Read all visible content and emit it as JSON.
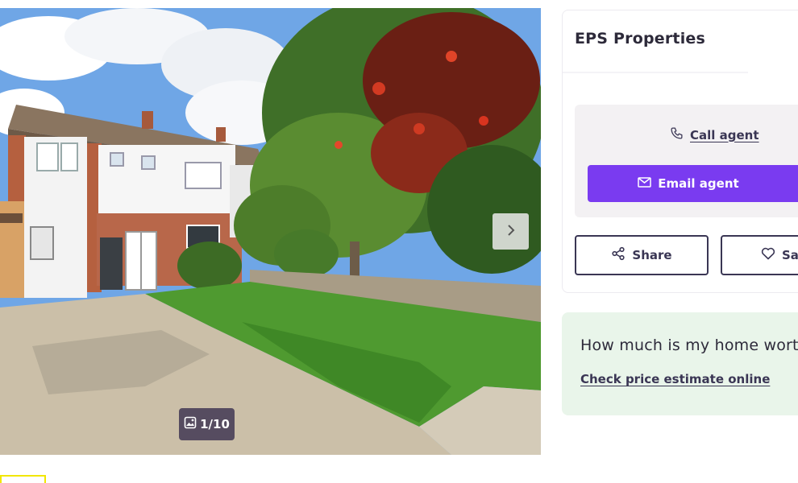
{
  "gallery": {
    "counter": "1/10",
    "icons": {
      "counter": "image-icon",
      "next": "chevron-right-icon"
    }
  },
  "agent": {
    "name": "EPS Properties",
    "call_label": "Call agent",
    "email_label": "Email agent",
    "share_label": "Share",
    "save_label": "Save",
    "icons": {
      "call": "phone-icon",
      "email": "envelope-icon",
      "share": "share-icon",
      "save": "heart-icon"
    }
  },
  "estimate": {
    "title": "How much is my home worth?",
    "link_label": "Check price estimate online"
  },
  "colors": {
    "primary": "#7a3bf0",
    "estimate_background": "#e9f5ea",
    "contact_panel": "#f3f1f3",
    "text": "#2d2a3a"
  }
}
